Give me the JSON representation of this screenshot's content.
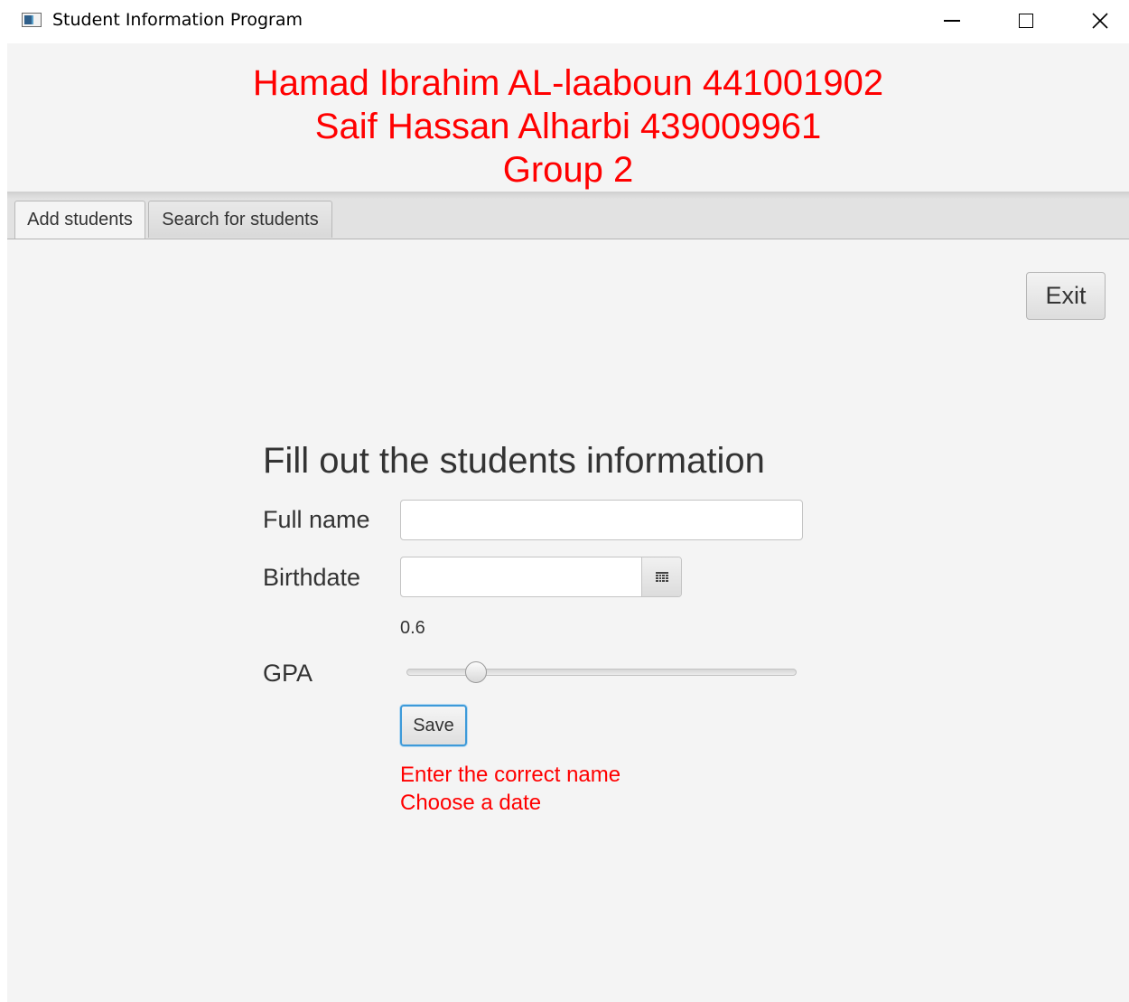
{
  "window": {
    "title": "Student Information Program"
  },
  "header": {
    "lines": [
      "Hamad Ibrahim AL-laaboun 441001902",
      "Saif Hassan Alharbi 439009961",
      "Group 2"
    ],
    "color": "#ff0000"
  },
  "tabs": [
    {
      "label": "Add students",
      "selected": true
    },
    {
      "label": "Search for students",
      "selected": false
    }
  ],
  "toolbar": {
    "exit_label": "Exit"
  },
  "form": {
    "title": "Fill out the students information",
    "full_name": {
      "label": "Full name",
      "value": "",
      "placeholder": ""
    },
    "birthdate": {
      "label": "Birthdate",
      "value": "",
      "placeholder": ""
    },
    "gpa": {
      "label": "GPA",
      "value_text": "0.6",
      "value": 0.6,
      "slider_level": 0.16
    },
    "save_label": "Save",
    "errors": [
      "Enter the correct name",
      "Choose a date"
    ],
    "error_color": "#ff0000",
    "accent": "#3d9ad9"
  },
  "icons": {
    "app": "app-window-icon",
    "calendar": "calendar-icon",
    "minimize": "minimize-icon",
    "maximize": "maximize-icon",
    "close": "close-icon"
  }
}
